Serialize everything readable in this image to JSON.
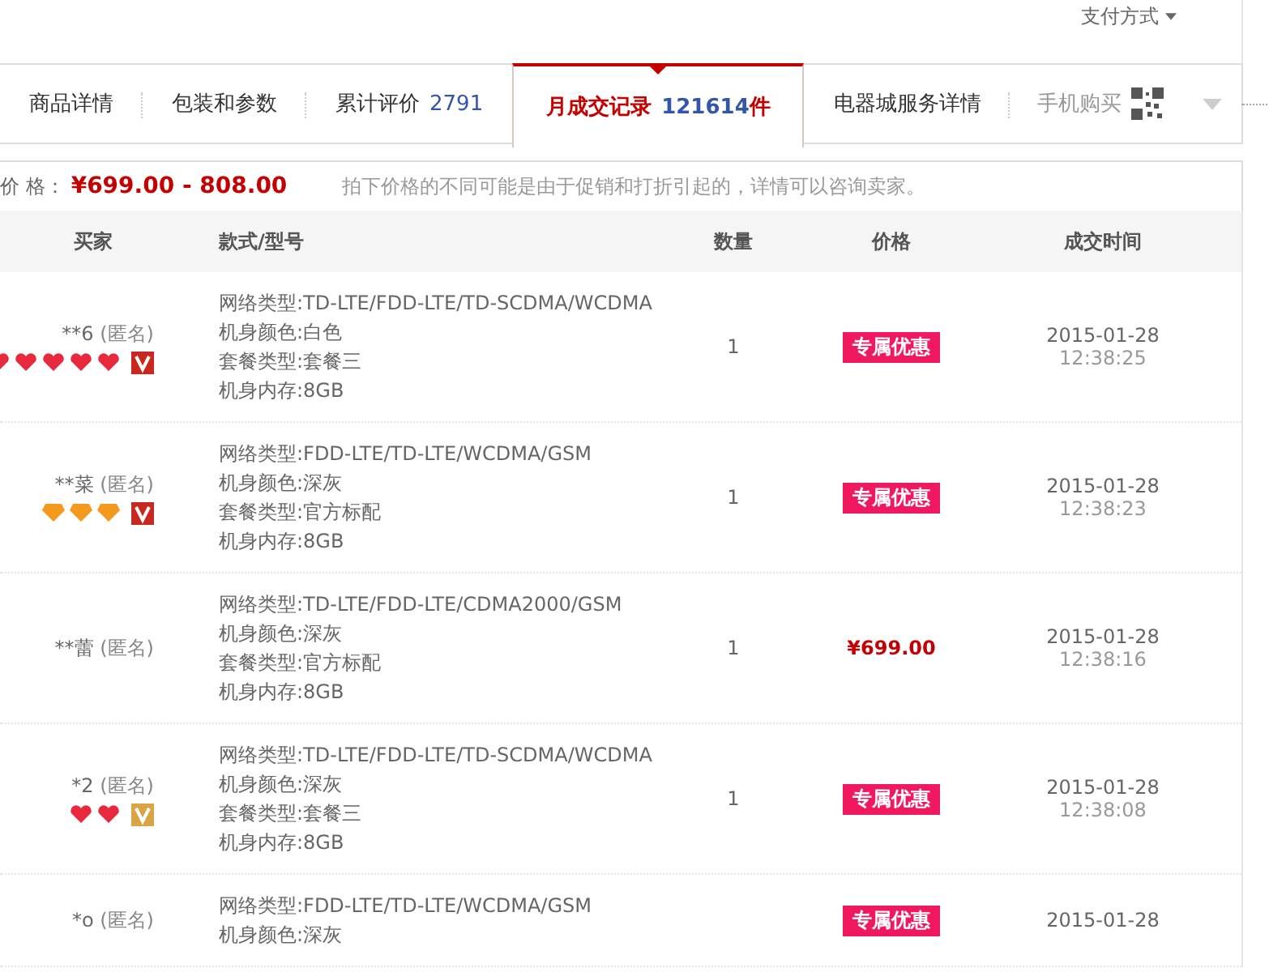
{
  "top_link": {
    "label": "支付方式"
  },
  "tabs": [
    {
      "label": "商品详情",
      "selected": false
    },
    {
      "label": "包装和参数",
      "selected": false
    },
    {
      "label": "累计评价",
      "count": "2791",
      "selected": false
    },
    {
      "label": "月成交记录",
      "count": "121614",
      "unit": "件",
      "selected": true
    },
    {
      "label": "电器城服务详情",
      "selected": false
    }
  ],
  "mobile_buy": {
    "label": "手机购买"
  },
  "price_bar": {
    "label": "价 格：",
    "range": "¥699.00 - 808.00",
    "note": "拍下价格的不同可能是由于促销和打折引起的，详情可以咨询卖家。"
  },
  "table": {
    "columns": [
      "买家",
      "款式/型号",
      "数量",
      "价格",
      "成交时间"
    ],
    "rows": [
      {
        "buyer": "**6",
        "anonymous": "(匿名)",
        "rank_icons": [
          {
            "kind": "heart"
          },
          {
            "kind": "heart"
          },
          {
            "kind": "heart"
          },
          {
            "kind": "heart"
          },
          {
            "kind": "heart"
          }
        ],
        "vip": {
          "color": "#c8281e"
        },
        "specs": [
          "网络类型:TD-LTE/FDD-LTE/TD-SCDMA/WCDMA",
          "机身颜色:白色",
          "套餐类型:套餐三",
          "机身内存:8GB"
        ],
        "quantity": "1",
        "price": {
          "kind": "tag",
          "text": "专属优惠"
        },
        "date": "2015-01-28",
        "time": "12:38:25"
      },
      {
        "buyer": "**菜",
        "anonymous": "(匿名)",
        "rank_icons": [
          {
            "kind": "diamond"
          },
          {
            "kind": "diamond"
          },
          {
            "kind": "diamond"
          }
        ],
        "vip": {
          "color": "#c8281e"
        },
        "specs": [
          "网络类型:FDD-LTE/TD-LTE/WCDMA/GSM",
          "机身颜色:深灰",
          "套餐类型:官方标配",
          "机身内存:8GB"
        ],
        "quantity": "1",
        "price": {
          "kind": "tag",
          "text": "专属优惠"
        },
        "date": "2015-01-28",
        "time": "12:38:23"
      },
      {
        "buyer": "**蕾",
        "anonymous": "(匿名)",
        "rank_icons": [],
        "specs": [
          "网络类型:TD-LTE/FDD-LTE/CDMA2000/GSM",
          "机身颜色:深灰",
          "套餐类型:官方标配",
          "机身内存:8GB"
        ],
        "quantity": "1",
        "price": {
          "kind": "amount",
          "text": "¥699.00"
        },
        "date": "2015-01-28",
        "time": "12:38:16"
      },
      {
        "buyer": "*2",
        "anonymous": "(匿名)",
        "rank_icons": [
          {
            "kind": "heart"
          },
          {
            "kind": "heart"
          }
        ],
        "vip": {
          "color": "#d9a441"
        },
        "specs": [
          "网络类型:TD-LTE/FDD-LTE/TD-SCDMA/WCDMA",
          "机身颜色:深灰",
          "套餐类型:套餐三",
          "机身内存:8GB"
        ],
        "quantity": "1",
        "price": {
          "kind": "tag",
          "text": "专属优惠"
        },
        "date": "2015-01-28",
        "time": "12:38:08"
      },
      {
        "buyer": "*o",
        "anonymous": "(匿名)",
        "rank_icons": [],
        "specs": [
          "网络类型:FDD-LTE/TD-LTE/WCDMA/GSM",
          "机身颜色:深灰"
        ],
        "price": {
          "kind": "tag",
          "text": "专属优惠"
        },
        "date": "2015-01-28"
      }
    ]
  }
}
